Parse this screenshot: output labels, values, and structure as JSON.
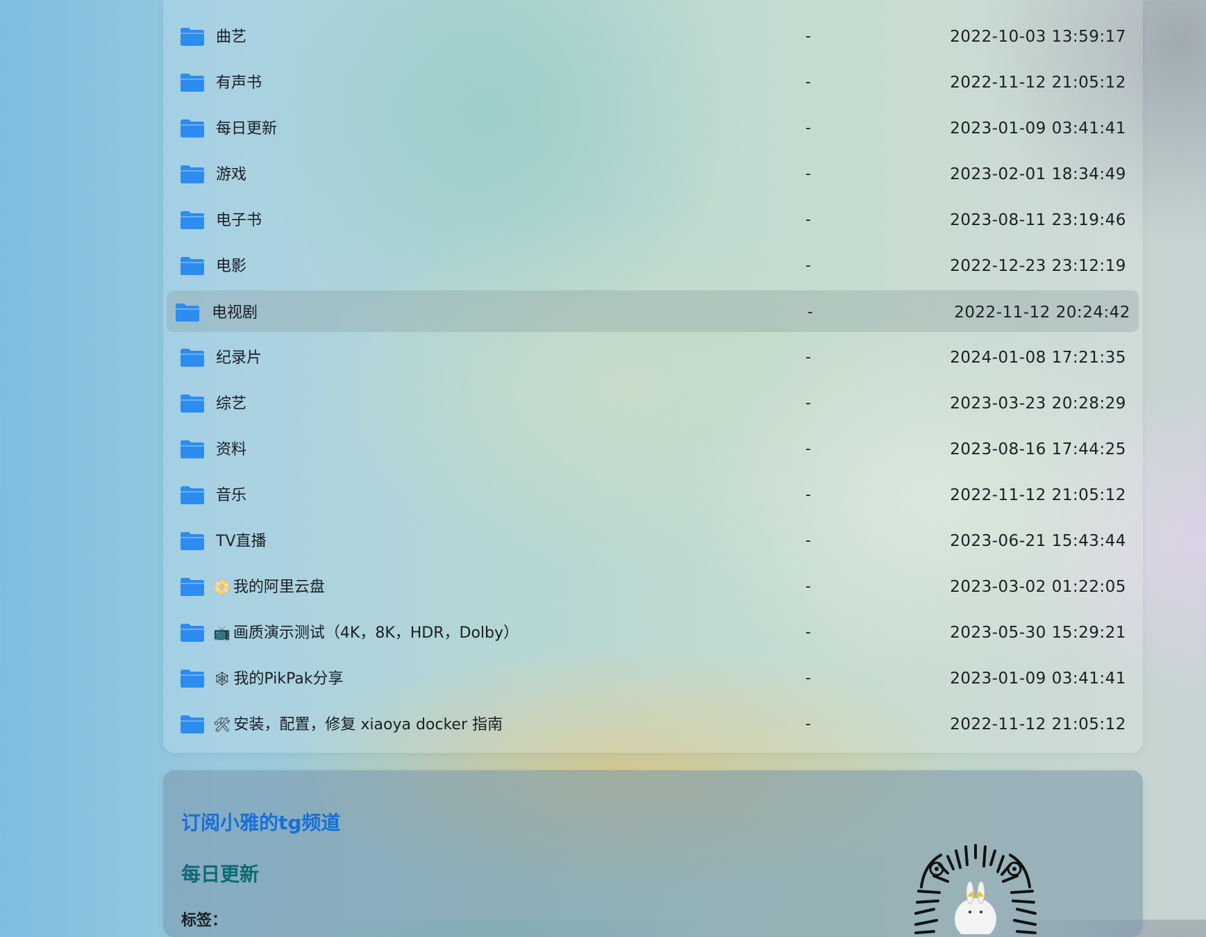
{
  "file_list": {
    "rows": [
      {
        "name": "曲艺",
        "emoji": "",
        "size": "-",
        "modified": "2022-10-03 13:59:17"
      },
      {
        "name": "有声书",
        "emoji": "",
        "size": "-",
        "modified": "2022-11-12 21:05:12"
      },
      {
        "name": "每日更新",
        "emoji": "",
        "size": "-",
        "modified": "2023-01-09 03:41:41"
      },
      {
        "name": "游戏",
        "emoji": "",
        "size": "-",
        "modified": "2023-02-01 18:34:49"
      },
      {
        "name": "电子书",
        "emoji": "",
        "size": "-",
        "modified": "2023-08-11 23:19:46"
      },
      {
        "name": "电影",
        "emoji": "",
        "size": "-",
        "modified": "2022-12-23 23:12:19"
      },
      {
        "name": "电视剧",
        "emoji": "",
        "size": "-",
        "modified": "2022-11-12 20:24:42"
      },
      {
        "name": "纪录片",
        "emoji": "",
        "size": "-",
        "modified": "2024-01-08 17:21:35"
      },
      {
        "name": "综艺",
        "emoji": "",
        "size": "-",
        "modified": "2023-03-23 20:28:29"
      },
      {
        "name": "资料",
        "emoji": "",
        "size": "-",
        "modified": "2023-08-16 17:44:25"
      },
      {
        "name": "音乐",
        "emoji": "",
        "size": "-",
        "modified": "2022-11-12 21:05:12"
      },
      {
        "name": "TV直播",
        "emoji": "",
        "size": "-",
        "modified": "2023-06-21 15:43:44"
      },
      {
        "name": "我的阿里云盘",
        "emoji": "📀",
        "size": "-",
        "modified": "2023-03-02 01:22:05"
      },
      {
        "name": "画质演示测试（4K，8K，HDR，Dolby）",
        "emoji": "📺",
        "size": "-",
        "modified": "2023-05-30 15:29:21"
      },
      {
        "name": "我的PikPak分享",
        "emoji": "🕸",
        "size": "-",
        "modified": "2023-01-09 03:41:41"
      },
      {
        "name": "安装，配置，修复 xiaoya docker 指南",
        "emoji": "🛠",
        "size": "-",
        "modified": "2022-11-12 21:05:12"
      }
    ]
  },
  "readme": {
    "link_text": "订阅小雅的tg频道",
    "heading": "每日更新",
    "tags_label": "标签："
  },
  "colors": {
    "folder_icon": "#2d8cf0",
    "link": "#1670d8",
    "heading": "#0e6a72"
  }
}
